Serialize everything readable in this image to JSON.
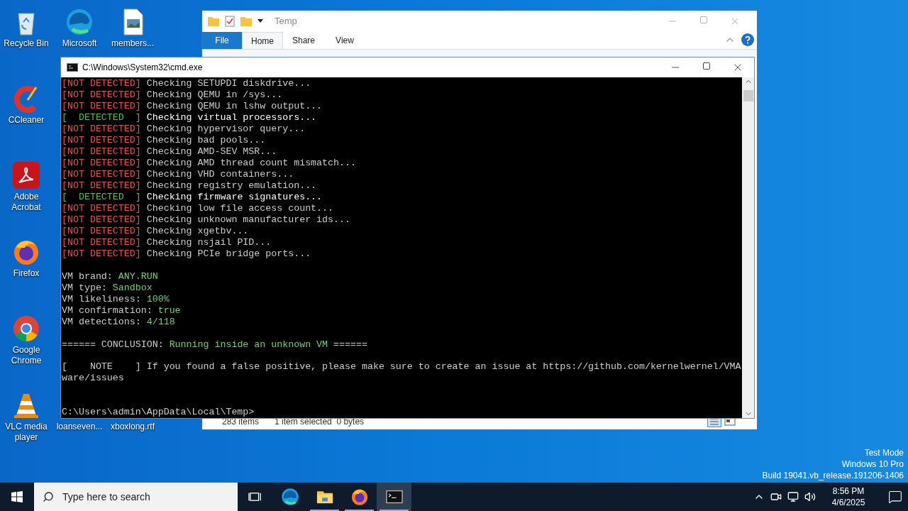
{
  "desktop": {
    "icons": [
      {
        "label": "Recycle Bin",
        "kind": "recycle"
      },
      {
        "label": "Microsoft",
        "kind": "edge"
      },
      {
        "label": "members...",
        "kind": "image"
      },
      {
        "label": "CCleaner",
        "kind": "ccleaner"
      },
      {
        "label": "Adobe Acrobat",
        "kind": "acrobat"
      },
      {
        "label": "Firefox",
        "kind": "firefox"
      },
      {
        "label": "Google Chrome",
        "kind": "chrome"
      },
      {
        "label": "VLC media player",
        "kind": "vlc"
      },
      {
        "label": "loanseven...",
        "kind": "hidden"
      },
      {
        "label": "xboxlong.rtf",
        "kind": "hidden"
      }
    ],
    "os_notice": [
      "Test Mode",
      "Windows 10 Pro",
      "Build 19041.vb_release.191206-1406"
    ]
  },
  "explorer": {
    "title": "Temp",
    "tabs": [
      {
        "label": "File",
        "kind": "file",
        "selected": false
      },
      {
        "label": "Home",
        "kind": "tab",
        "selected": true
      },
      {
        "label": "Share",
        "kind": "tab",
        "selected": false
      },
      {
        "label": "View",
        "kind": "tab",
        "selected": false
      }
    ],
    "status": {
      "items": "283 items",
      "selection": "1 item selected  0 bytes"
    }
  },
  "cmd": {
    "title": "C:\\Windows\\System32\\cmd.exe",
    "checks": [
      {
        "tag": "[NOT DETECTED]",
        "detected": false,
        "text": "Checking SETUPDI diskdrive..."
      },
      {
        "tag": "[NOT DETECTED]",
        "detected": false,
        "text": "Checking QEMU in /sys..."
      },
      {
        "tag": "[NOT DETECTED]",
        "detected": false,
        "text": "Checking QEMU in lshw output..."
      },
      {
        "tag": "[  DETECTED  ]",
        "detected": true,
        "text": "Checking virtual processors..."
      },
      {
        "tag": "[NOT DETECTED]",
        "detected": false,
        "text": "Checking hypervisor query..."
      },
      {
        "tag": "[NOT DETECTED]",
        "detected": false,
        "text": "Checking bad pools..."
      },
      {
        "tag": "[NOT DETECTED]",
        "detected": false,
        "text": "Checking AMD-SEV MSR..."
      },
      {
        "tag": "[NOT DETECTED]",
        "detected": false,
        "text": "Checking AMD thread count mismatch..."
      },
      {
        "tag": "[NOT DETECTED]",
        "detected": false,
        "text": "Checking VHD containers..."
      },
      {
        "tag": "[NOT DETECTED]",
        "detected": false,
        "text": "Checking registry emulation..."
      },
      {
        "tag": "[  DETECTED  ]",
        "detected": true,
        "text": "Checking firmware signatures..."
      },
      {
        "tag": "[NOT DETECTED]",
        "detected": false,
        "text": "Checking low file access count..."
      },
      {
        "tag": "[NOT DETECTED]",
        "detected": false,
        "text": "Checking unknown manufacturer ids..."
      },
      {
        "tag": "[NOT DETECTED]",
        "detected": false,
        "text": "Checking xgetbv..."
      },
      {
        "tag": "[NOT DETECTED]",
        "detected": false,
        "text": "Checking nsjail PID..."
      },
      {
        "tag": "[NOT DETECTED]",
        "detected": false,
        "text": "Checking PCIe bridge ports..."
      }
    ],
    "summary": [
      {
        "label": "VM brand:",
        "value": "ANY.RUN"
      },
      {
        "label": "VM type:",
        "value": "Sandbox"
      },
      {
        "label": "VM likeliness:",
        "value": "100%"
      },
      {
        "label": "VM confirmation:",
        "value": "true"
      },
      {
        "label": "VM detections:",
        "value": "4/118"
      }
    ],
    "conclusion": {
      "prefix": "====== CONCLUSION:",
      "value": "Running inside an unknown VM",
      "suffix": "======"
    },
    "note": {
      "tag": "[    NOTE    ]",
      "lines": [
        "If you found a false positive, please make sure to create an issue at https://github.com/kernelwernel/VMA",
        "ware/issues"
      ]
    },
    "prompt": "C:\\Users\\admin\\AppData\\Local\\Temp>"
  },
  "taskbar": {
    "search": {
      "placeholder": "Type here to search"
    },
    "apps": [
      {
        "kind": "taskview",
        "running": false,
        "selected": false
      },
      {
        "kind": "edge",
        "running": false,
        "selected": false
      },
      {
        "kind": "folder",
        "running": true,
        "selected": false
      },
      {
        "kind": "firefox",
        "running": true,
        "selected": false
      },
      {
        "kind": "console",
        "running": true,
        "selected": true
      }
    ],
    "time": "8:56 PM",
    "date": "4/6/2025"
  }
}
